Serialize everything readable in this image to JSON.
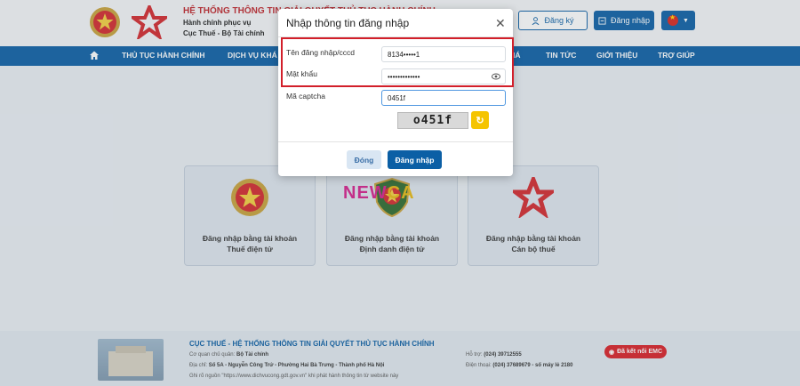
{
  "header": {
    "title": "HỆ THỐNG THÔNG TIN GIẢI QUYẾT THỦ TỤC HÀNH CHÍNH",
    "subtitle_1": "Hành chính phục vụ",
    "subtitle_2": "Cục Thuế - Bộ Tài chính",
    "register_label": "Đăng ký",
    "login_label": "Đăng nhập"
  },
  "nav": {
    "items": [
      "THỦ TỤC HÀNH CHÍNH",
      "DỊCH VỤ KHÁ",
      "IÁ",
      "TIN TỨC",
      "GIỚI THIỆU",
      "TRỢ GIÚP"
    ]
  },
  "cards": [
    {
      "line1": "Đăng nhập bằng tài khoản",
      "line2": "Thuế điện tử"
    },
    {
      "line1": "Đăng nhập bằng tài khoản",
      "line2": "Định danh điện tử"
    },
    {
      "line1": "Đăng nhập bằng tài khoản",
      "line2": "Cán bộ thuế"
    }
  ],
  "watermark": {
    "part1": "NEW",
    "part2": "CA"
  },
  "modal": {
    "title": "Nhập thông tin đăng nhập",
    "username_label": "Tên đăng nhập/cccd",
    "username_value": "8134•••••1",
    "password_label": "Mật khẩu",
    "password_value": "•••••••••••••",
    "captcha_label": "Mã captcha",
    "captcha_value": "0451f",
    "captcha_image_text": "o451f",
    "close_label": "Đóng",
    "submit_label": "Đăng nhập"
  },
  "footer": {
    "title": "CỤC THUẾ - HỆ THỐNG THÔNG TIN GIẢI QUYẾT THỦ TỤC HÀNH CHÍNH",
    "agency_label": "Cơ quan chủ quản:",
    "agency_value": "Bộ Tài chính",
    "address_label": "Địa chỉ:",
    "address_value": "Số 5A - Nguyễn Công Trứ - Phường Hai Bà Trưng - Thành phố Hà Nội",
    "source_note": "Ghi rõ nguồn \"https://www.dichvucong.gdt.gov.vn\" khi phát hành thông tin từ website này",
    "hotline_label": "Hỗ trợ:",
    "hotline_value": "(024) 39712555",
    "phone_label": "Điện thoại:",
    "phone_value": "(024) 37689679 - số máy lẻ 2180",
    "emc_label": "Đã kết nối EMC"
  },
  "colors": {
    "brand": "#0b5fa5",
    "accent_red": "#c0272d",
    "captcha_refresh": "#f5c400",
    "highlight_box": "#d21f2a"
  }
}
